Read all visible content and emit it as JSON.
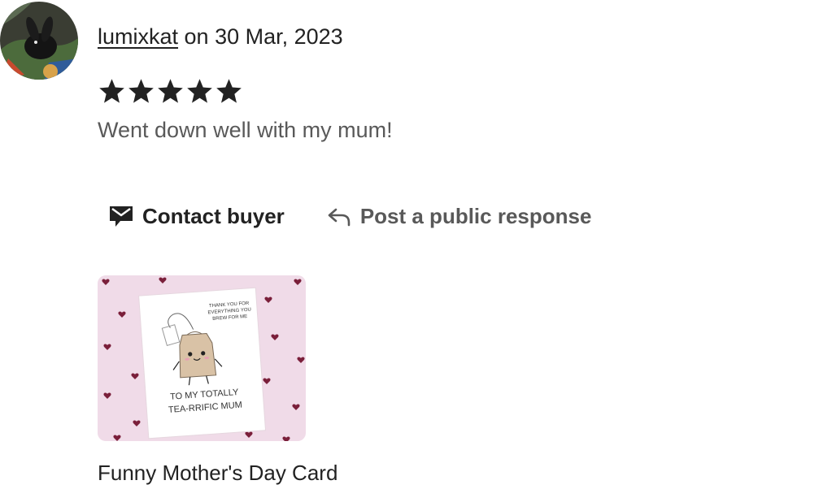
{
  "review": {
    "reviewer_name": "lumixkat",
    "date_prefix": " on ",
    "date": "30 Mar, 2023",
    "rating": 5,
    "rating_max": 5,
    "text": "Went down well with my mum!"
  },
  "actions": {
    "contact_label": "Contact buyer",
    "contact_icon": "envelope-icon",
    "respond_label": "Post a public response",
    "respond_icon": "reply-arrow-icon"
  },
  "product": {
    "title": "Funny Mother's Day Card",
    "card_text_top_1": "THANK YOU FOR",
    "card_text_top_2": "EVERYTHING YOU",
    "card_text_top_3": "BREW FOR ME",
    "card_text_bottom_1": "TO MY TOTALLY",
    "card_text_bottom_2": "TEA-RRIFIC MUM"
  },
  "colors": {
    "text_primary": "#222222",
    "text_secondary": "#595959",
    "star": "#222222",
    "thumb_background": "#f0dbe8",
    "heart": "#7a1f3a"
  }
}
